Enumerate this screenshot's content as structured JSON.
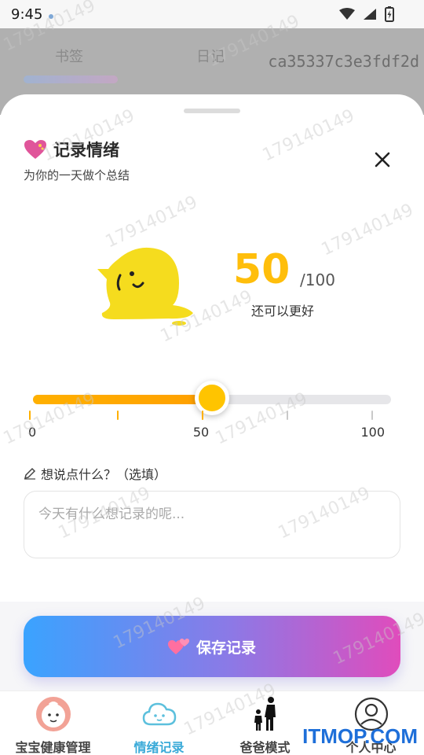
{
  "status_bar": {
    "time": "9:45"
  },
  "background_app": {
    "tab_1": "书签",
    "tab_2": "日记",
    "hash_text": "ca35337c3e3fdf2d"
  },
  "sheet": {
    "title": "记录情绪",
    "subtitle": "为你的一天做个总结",
    "score": {
      "value": "50",
      "total": "/100",
      "label": "还可以更好"
    },
    "slider": {
      "value": 50,
      "min": 0,
      "max": 100,
      "ticks": [
        "0",
        "50",
        "100"
      ]
    },
    "note": {
      "label": "想说点什么？（选填）",
      "placeholder": "今天有什么想记录的呢..."
    },
    "save_button": "保存记录"
  },
  "bottom_nav": [
    {
      "label": "宝宝健康管理",
      "icon": "baby-face-icon",
      "active": false
    },
    {
      "label": "情绪记录",
      "icon": "cloud-face-icon",
      "active": true
    },
    {
      "label": "爸爸模式",
      "icon": "father-child-icon",
      "active": false
    },
    {
      "label": "个人中心",
      "icon": "user-circle-icon",
      "active": false
    }
  ],
  "watermark": "179140149",
  "brand": "ITMOP.COM",
  "colors": {
    "score": "#ffbe0b",
    "slider_fill": "#ffb000",
    "active_nav": "#3aaad8",
    "save_gradient_start": "#3aa3ff",
    "save_gradient_end": "#e04cbc"
  }
}
